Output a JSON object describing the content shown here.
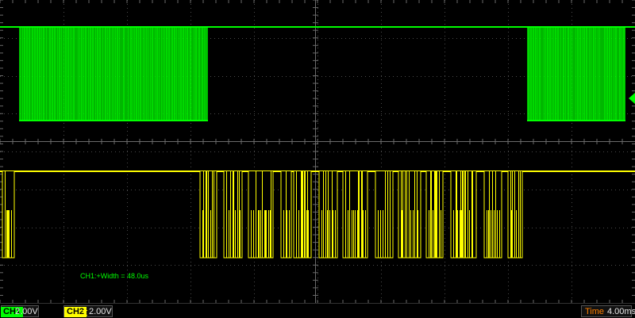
{
  "screen": {
    "grid_divisions": {
      "horizontal": 10,
      "vertical": 8
    },
    "colors": {
      "background": "#000000",
      "grid": "#4a4a4a",
      "ch1": "#00ff00",
      "ch2": "#ffff00"
    }
  },
  "measurement": {
    "text": "CH1:+Width = 48.0us"
  },
  "status": {
    "ch1": {
      "label": "CH1",
      "scale": "2.00V",
      "coupling_icon": "dc-coupling-icon",
      "color": "#00ff00"
    },
    "ch2": {
      "label": "CH2",
      "scale": "2.00V",
      "coupling_icon": "dc-coupling-icon",
      "color": "#ffff00"
    },
    "time": {
      "label": "Time",
      "value": "4.00ms"
    }
  }
}
